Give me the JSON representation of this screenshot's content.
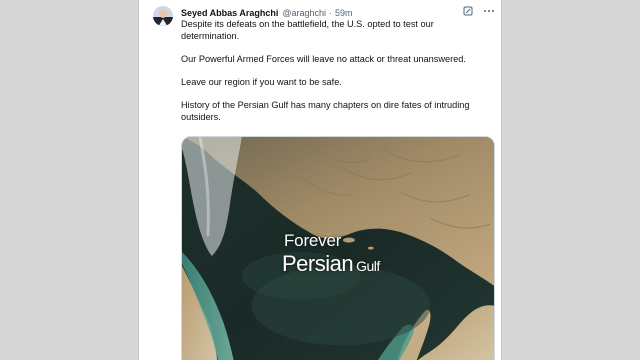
{
  "tweet": {
    "author_name": "Seyed Abbas Araghchi",
    "handle": "@araghchi",
    "separator": "·",
    "time": "59m",
    "paragraphs": [
      "Despite its defeats on the battlefield, the U.S. opted to test our determination.",
      "Our Powerful Armed Forces will leave no attack or threat unanswered.",
      "Leave our region if you want to be safe.",
      "History of the Persian Gulf has many chapters on dire fates of intruding outsiders."
    ],
    "media": {
      "overlay_line1": "Forever",
      "overlay_line2_main": "Persian",
      "overlay_line2_small": "Gulf"
    }
  },
  "icons": {
    "grok": "grok-icon",
    "more": "more-icon"
  },
  "colors": {
    "text": "#0f1419",
    "muted": "#536471",
    "background": "#d6d6d6"
  }
}
